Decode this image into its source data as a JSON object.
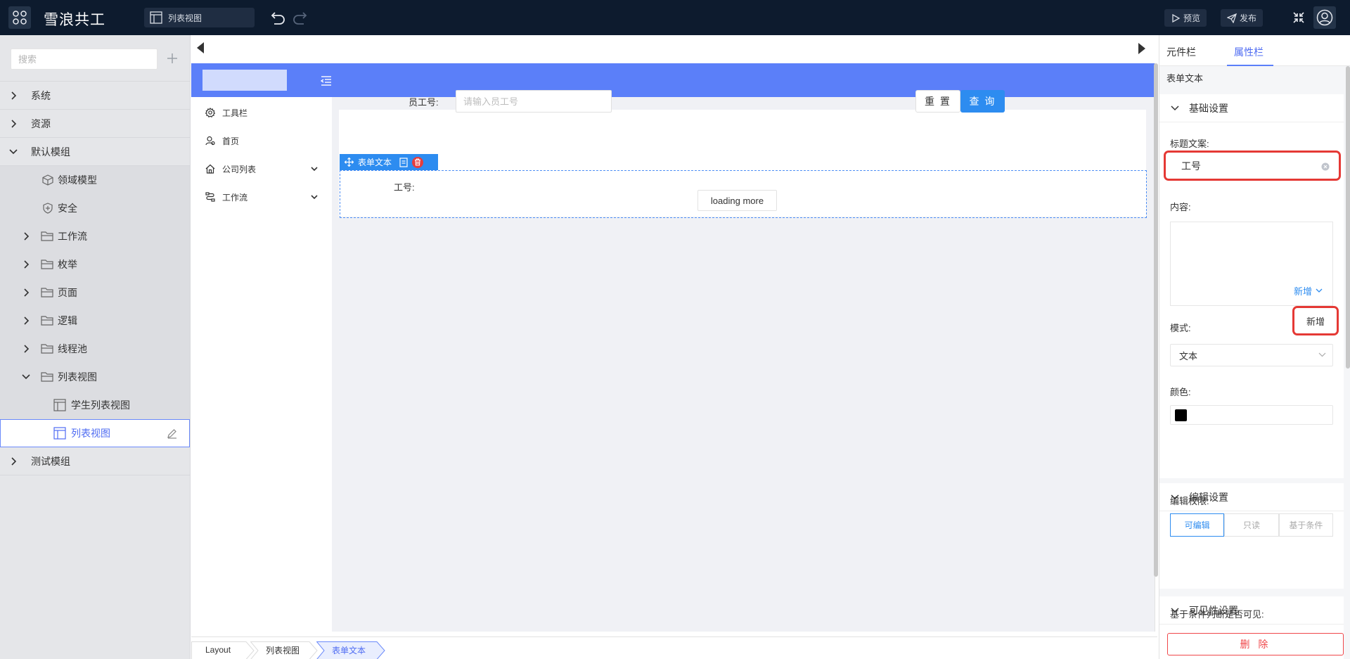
{
  "app": {
    "title": "雪浪共工"
  },
  "header": {
    "view_tab": "列表视图",
    "preview_label": "预览",
    "publish_label": "发布"
  },
  "sidebar": {
    "search_placeholder": "搜索",
    "items": [
      {
        "label": "系统"
      },
      {
        "label": "资源"
      },
      {
        "label": "默认模组"
      },
      {
        "label": "领域模型"
      },
      {
        "label": "安全"
      },
      {
        "label": "工作流"
      },
      {
        "label": "枚举"
      },
      {
        "label": "页面"
      },
      {
        "label": "逻辑"
      },
      {
        "label": "线程池"
      },
      {
        "label": "列表视图"
      },
      {
        "label": "学生列表视图"
      },
      {
        "label": "列表视图"
      },
      {
        "label": "测试模组"
      }
    ]
  },
  "preview": {
    "menu": [
      {
        "label": "工具栏"
      },
      {
        "label": "首页"
      },
      {
        "label": "公司列表"
      },
      {
        "label": "工作流"
      }
    ],
    "form": {
      "employee_label": "员工号:",
      "employee_placeholder": "请输入员工号",
      "reset_label": "重 置",
      "query_label": "查 询"
    },
    "selected_component": {
      "toolbar_label": "表单文本",
      "field_label": "工号:",
      "loading_label": "loading more"
    }
  },
  "breadcrumb": {
    "items": [
      "Layout",
      "列表视图",
      "表单文本"
    ]
  },
  "panel": {
    "tab_components": "元件栏",
    "tab_properties": "属性栏",
    "component_name": "表单文本",
    "basic": {
      "header": "基础设置",
      "title_label": "标题文案:",
      "title_value": "工号",
      "content_label": "内容:",
      "add_link": "新增",
      "add_popup": "新增",
      "mode_label": "模式:",
      "mode_value": "文本",
      "color_label": "颜色:",
      "color_value": "#000000"
    },
    "edit": {
      "header": "编辑设置",
      "permission_label": "编辑权限:",
      "options": [
        "可编辑",
        "只读",
        "基于条件"
      ],
      "selected": "可编辑"
    },
    "visibility": {
      "header": "可见性设置",
      "condition_label": "基于条件判断是否可见:"
    },
    "delete_label": "删 除"
  },
  "colors": {
    "topbar": "#0d1b2e",
    "accent": "#5b7ff9",
    "primary_button": "#2d8cf0",
    "highlight_border": "#e53935",
    "danger": "#f0474a"
  }
}
